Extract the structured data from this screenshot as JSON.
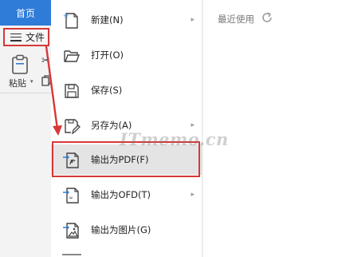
{
  "ribbon": {
    "home_tab": "首页",
    "file_button": "文件",
    "paste_label": "粘贴",
    "paste_caret": "▾",
    "cut_icon": "scissors-icon",
    "copy_icon": "copy-icon"
  },
  "menu": {
    "items": [
      {
        "label": "新建(N)",
        "icon": "new-document-icon",
        "has_submenu": true
      },
      {
        "label": "打开(O)",
        "icon": "folder-open-icon",
        "has_submenu": false
      },
      {
        "label": "保存(S)",
        "icon": "save-icon",
        "has_submenu": false
      },
      {
        "label": "另存为(A)",
        "icon": "save-as-icon",
        "has_submenu": true
      },
      {
        "label": "输出为PDF(F)",
        "icon": "export-pdf-icon",
        "has_submenu": false,
        "highlighted": true
      },
      {
        "label": "输出为OFD(T)",
        "icon": "export-ofd-icon",
        "has_submenu": true
      },
      {
        "label": "输出为图片(G)",
        "icon": "export-image-icon",
        "has_submenu": false
      }
    ],
    "submenu_arrow": "▸"
  },
  "recent": {
    "title": "最近使用",
    "refresh_icon": "refresh-icon"
  },
  "watermark": "ITmemo.cn",
  "colors": {
    "accent_blue": "#2f7bd8",
    "annotation_red": "#d63838",
    "highlight_gray": "#e4e4e4"
  }
}
